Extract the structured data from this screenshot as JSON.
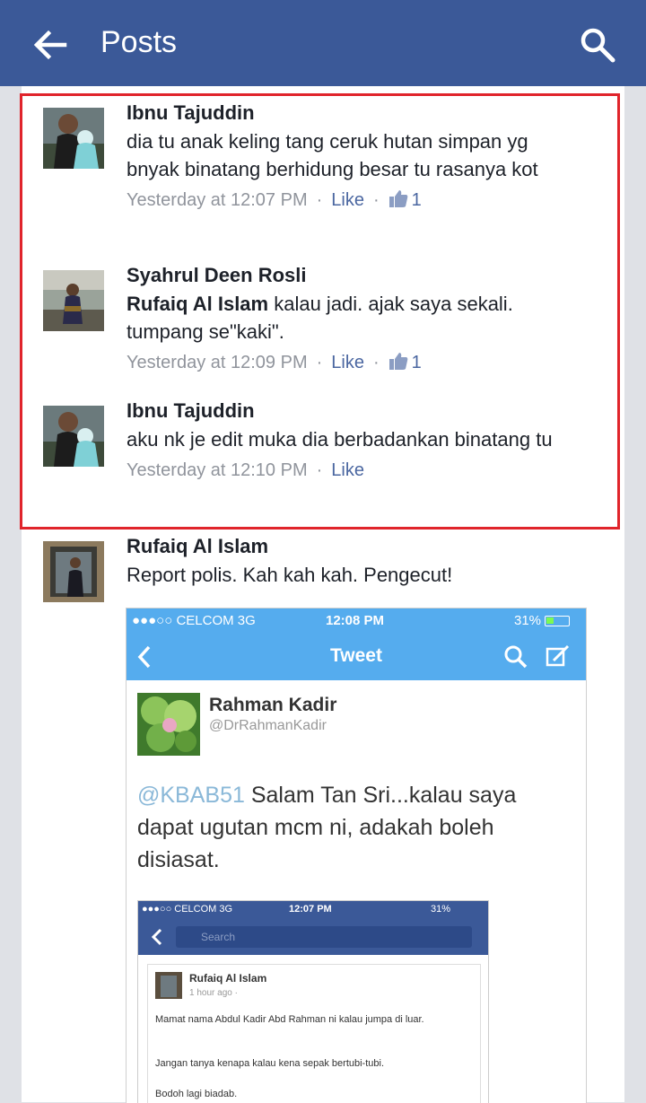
{
  "header": {
    "title": "Posts",
    "back_icon": "arrow-left-icon",
    "search_icon": "search-icon",
    "color": "#3b5998"
  },
  "comments": [
    {
      "author": "Ibnu Tajuddin",
      "mention": "",
      "text": "dia tu anak keling tang ceruk hutan simpan yg bnyak binatang berhidung besar tu rasanya kot",
      "time": "Yesterday at 12:07 PM",
      "like_label": "Like",
      "like_count": "1"
    },
    {
      "author": "Syahrul Deen Rosli",
      "mention": "Rufaiq Al Islam",
      "text": " kalau jadi. ajak saya sekali. tumpang se\"kaki\".",
      "time": "Yesterday at 12:09 PM",
      "like_label": "Like",
      "like_count": "1"
    },
    {
      "author": "Ibnu Tajuddin",
      "mention": "",
      "text": "aku nk je edit muka dia berbadankan binatang tu",
      "time": "Yesterday at 12:10 PM",
      "like_label": "Like",
      "like_count": ""
    },
    {
      "author": "Rufaiq Al Islam",
      "mention": "",
      "text": "Report polis. Kah kah kah. Pengecut!",
      "time": "",
      "like_label": "",
      "like_count": ""
    }
  ],
  "screenshot": {
    "status_left": "●●●○○ CELCOM  3G",
    "status_time": "12:08 PM",
    "status_battery": "31%",
    "nav_title": "Tweet",
    "user_name": "Rahman Kadir",
    "user_handle": "@DrRahmanKadir",
    "tweet_mention": "@KBAB51",
    "tweet_text": " Salam Tan Sri...kalau saya dapat ugutan mcm ni, adakah boleh disiasat.",
    "inner": {
      "status_left": "●●●○○ CELCOM  3G",
      "status_time": "12:07 PM",
      "status_battery": "31%",
      "search_placeholder": "Search",
      "post_author": "Rufaiq Al Islam",
      "post_time": "1 hour ago · ",
      "post_line1": "Mamat nama Abdul Kadir Abd Rahman ni kalau jumpa di luar.",
      "post_line2": "Jangan tanya kenapa kalau kena sepak bertubi-tubi.",
      "post_line3": "Bodoh lagi biadab."
    }
  }
}
